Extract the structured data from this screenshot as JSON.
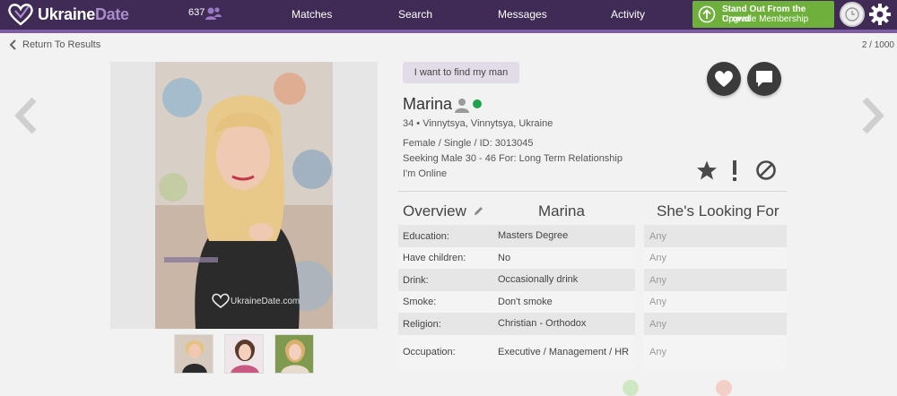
{
  "header": {
    "logo_part1": "Ukraine",
    "logo_part2": "Date",
    "message_count": "637",
    "nav": [
      "Matches",
      "Search",
      "Messages",
      "Activity"
    ],
    "upgrade_line1": "Stand Out From the Crowd",
    "upgrade_line2": "Upgrade Membership",
    "colors": {
      "bar": "#3f2b55",
      "accent": "#7d5ca3",
      "upgrade": "#6fb03c"
    }
  },
  "subheader": {
    "back_label": "Return To Results",
    "pager": "2 / 1000"
  },
  "photo": {
    "watermark": "UkraineDate.com"
  },
  "profile": {
    "goal": "I want to find my man",
    "name": "Marina",
    "status_color": "#1fa34a",
    "location": "34 • Vinnytsya, Vinnytsya, Ukraine",
    "details": "Female / Single / ID: 3013045",
    "seeking": "Seeking Male 30 - 46 For: Long Term Relationship",
    "online": "I'm Online"
  },
  "overview": {
    "heading": "Overview",
    "col_her": "Marina",
    "col_wants": "She's Looking For",
    "rows": [
      {
        "label": "Education:",
        "value": "Masters Degree",
        "want": "Any"
      },
      {
        "label": "Have children:",
        "value": "No",
        "want": "Any"
      },
      {
        "label": "Drink:",
        "value": "Occasionally drink",
        "want": "Any"
      },
      {
        "label": "Smoke:",
        "value": "Don't smoke",
        "want": "Any"
      },
      {
        "label": "Religion:",
        "value": "Christian - Orthodox",
        "want": "Any"
      },
      {
        "label": "Occupation:",
        "value": "Executive / Management / HR",
        "want": "Any"
      }
    ]
  },
  "icons": {
    "like": "heart-icon",
    "message": "chat-icon",
    "favorite": "star-icon",
    "report": "exclamation-icon",
    "block": "block-icon"
  }
}
